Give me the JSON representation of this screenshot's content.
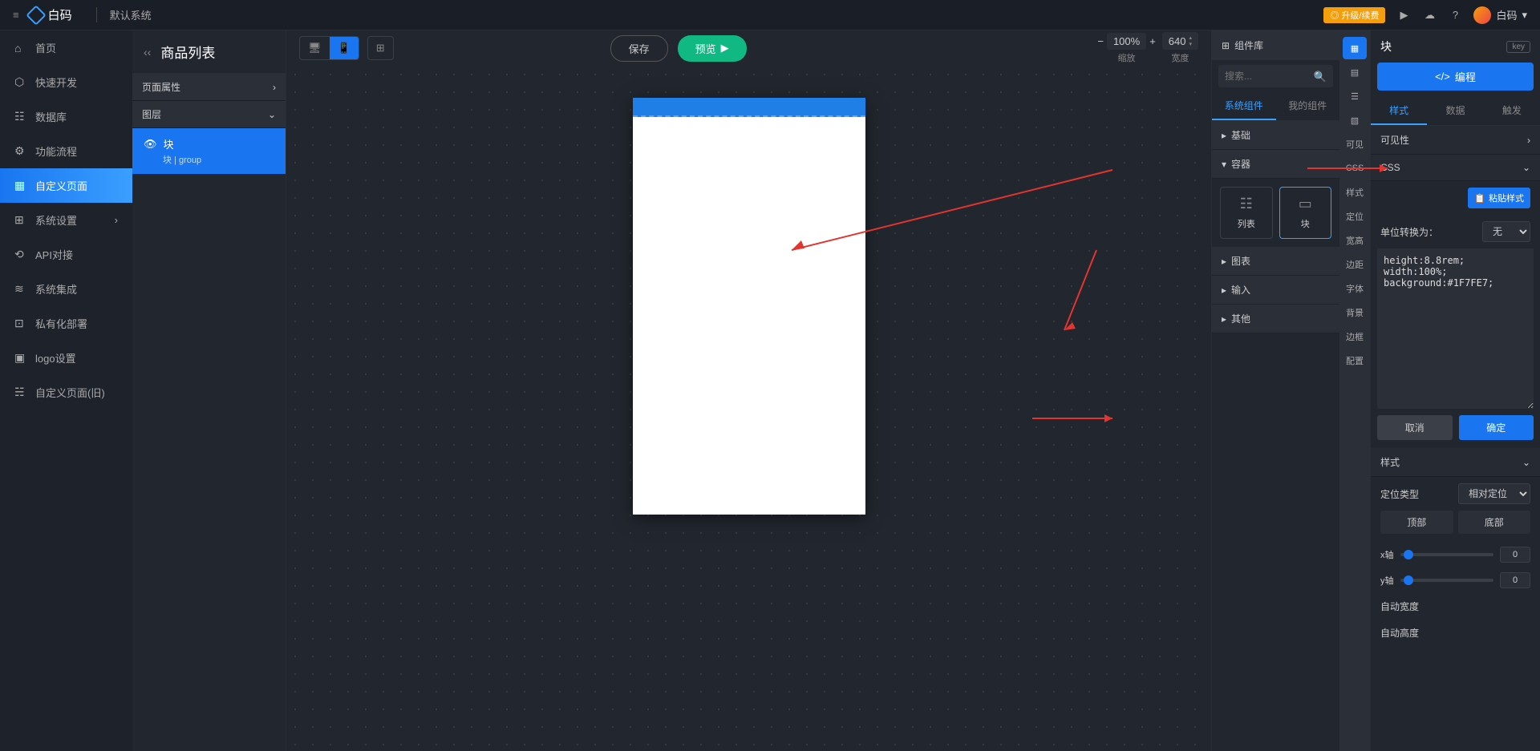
{
  "header": {
    "brand": "白码",
    "system": "默认系统",
    "upgrade": "◎ 升级/续费",
    "user": "白码"
  },
  "leftNav": [
    {
      "icon": "⌂",
      "label": "首页"
    },
    {
      "icon": "⬡",
      "label": "快速开发"
    },
    {
      "icon": "☷",
      "label": "数据库"
    },
    {
      "icon": "⚙",
      "label": "功能流程"
    },
    {
      "icon": "▦",
      "label": "自定义页面",
      "active": true
    },
    {
      "icon": "⊞",
      "label": "系统设置",
      "sub": true
    },
    {
      "icon": "⟲",
      "label": "API对接"
    },
    {
      "icon": "≋",
      "label": "系统集成"
    },
    {
      "icon": "⊡",
      "label": "私有化部署"
    },
    {
      "icon": "▣",
      "label": "logo设置"
    },
    {
      "icon": "☵",
      "label": "自定义页面(旧)"
    }
  ],
  "pageTitle": "商品列表",
  "panel2": {
    "pageAttr": "页面属性",
    "layers": "图层",
    "layer1": {
      "name": "块",
      "sub": "块",
      "type": "group"
    }
  },
  "toolbar": {
    "save": "保存",
    "preview": "预览",
    "zoom": "100%",
    "zoomLbl": "缩放",
    "width": "640",
    "widthLbl": "宽度"
  },
  "compLib": {
    "title": "组件库",
    "search": "搜索...",
    "tab1": "系统组件",
    "tab2": "我的组件",
    "cats": {
      "basic": "基础",
      "container": "容器",
      "chart": "图表",
      "input": "输入",
      "other": "其他"
    },
    "items": {
      "list": "列表",
      "block": "块"
    }
  },
  "rail": [
    "▦",
    "▤",
    "☰",
    "▧",
    "可见",
    "CSS",
    "样式",
    "定位",
    "宽高",
    "边距",
    "字体",
    "背景",
    "边框",
    "配置"
  ],
  "props": {
    "title": "块",
    "key": "key",
    "code": "编程",
    "tabs": {
      "style": "样式",
      "data": "数据",
      "trigger": "触发"
    },
    "visibility": "可见性",
    "css": "CSS",
    "paste": "粘贴样式",
    "unitLabel": "单位转换为：",
    "unit": "无",
    "cssValue": "height:8.8rem;\nwidth:100%;\nbackground:#1F7FE7;",
    "cancel": "取消",
    "confirm": "确定",
    "styleSection": "样式",
    "posType": "定位类型",
    "posVal": "相对定位",
    "top": "顶部",
    "bottom": "底部",
    "xAxis": "x轴",
    "yAxis": "y轴",
    "autoW": "自动宽度",
    "autoH": "自动高度",
    "zero": "0"
  }
}
